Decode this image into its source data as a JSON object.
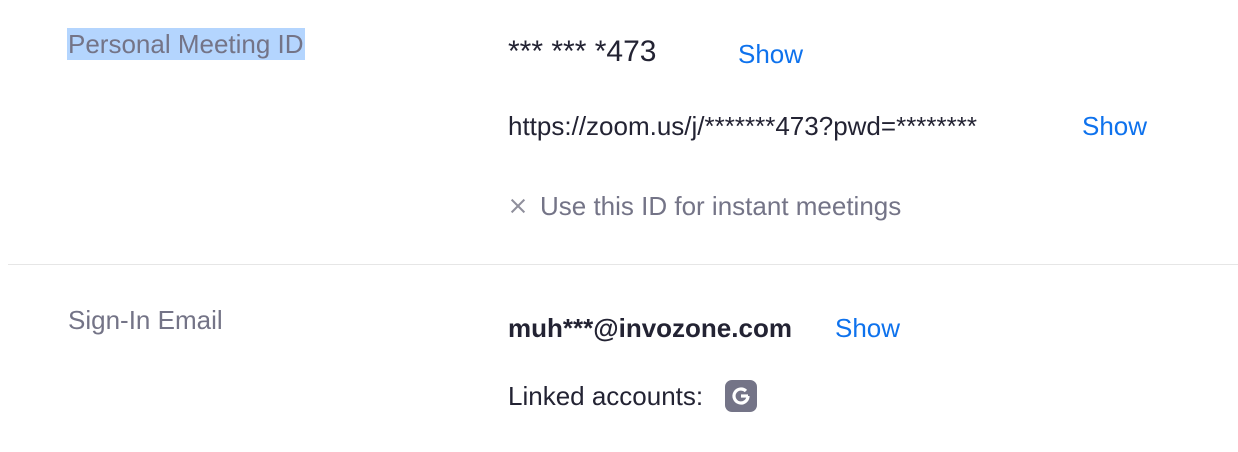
{
  "pmi_section": {
    "label": "Personal Meeting ID",
    "meeting_id": "*** *** *473",
    "show_id_label": "Show",
    "meeting_url": "https://zoom.us/j/*******473?pwd=********",
    "show_url_label": "Show",
    "instant_option_label": "Use this ID for instant meetings",
    "instant_option_icon": "close-icon"
  },
  "email_section": {
    "label": "Sign-In Email",
    "email": "muh***@invozone.com",
    "show_email_label": "Show",
    "linked_accounts_label": "Linked accounts:",
    "linked_account_icon": "google-icon"
  },
  "colors": {
    "link": "#0e72ed",
    "label_gray": "#747487",
    "text_dark": "#232333",
    "selection": "#b4d5fe"
  }
}
